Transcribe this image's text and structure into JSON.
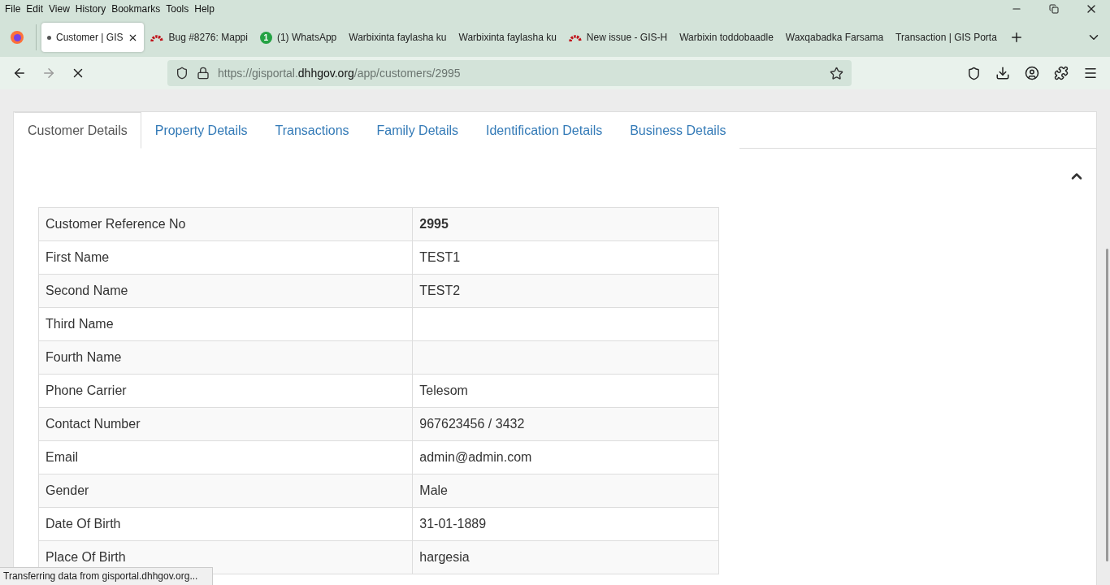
{
  "menu": [
    "File",
    "Edit",
    "View",
    "History",
    "Bookmarks",
    "Tools",
    "Help"
  ],
  "browser_tabs": [
    {
      "title": "Customer | GIS",
      "selected": true,
      "kind": "dot"
    },
    {
      "title": "Bug #8276: Mappi",
      "selected": false,
      "kind": "arc"
    },
    {
      "title": "(1) WhatsApp",
      "selected": false,
      "kind": "chat",
      "badge": "1"
    },
    {
      "title": "Warbixinta faylasha ku",
      "selected": false,
      "kind": "plain"
    },
    {
      "title": "Warbixinta faylasha ku",
      "selected": false,
      "kind": "plain"
    },
    {
      "title": "New issue - GIS-H",
      "selected": false,
      "kind": "arc"
    },
    {
      "title": "Warbixin toddobaadle",
      "selected": false,
      "kind": "plain"
    },
    {
      "title": "Waxqabadka Farsama",
      "selected": false,
      "kind": "plain"
    },
    {
      "title": "Transaction | GIS Porta",
      "selected": false,
      "kind": "plain"
    }
  ],
  "address": {
    "prefix": "https://gisportal.",
    "domain": "dhhgov.org",
    "path": "/app/customers/2995"
  },
  "page_tabs": [
    {
      "label": "Customer Details",
      "selected": true
    },
    {
      "label": "Property Details",
      "selected": false
    },
    {
      "label": "Transactions",
      "selected": false
    },
    {
      "label": "Family Details",
      "selected": false
    },
    {
      "label": "Identification Details",
      "selected": false
    },
    {
      "label": "Business Details",
      "selected": false
    }
  ],
  "details": [
    {
      "label": "Customer Reference No",
      "value": "2995",
      "bold": true
    },
    {
      "label": "First Name",
      "value": "TEST1",
      "bold": false
    },
    {
      "label": "Second Name",
      "value": "TEST2",
      "bold": false
    },
    {
      "label": "Third Name",
      "bold": false
    },
    {
      "label": "Fourth Name",
      "bold": false
    },
    {
      "label": "Phone Carrier",
      "value": "Telesom",
      "bold": false
    },
    {
      "label": "Contact Number",
      "value": "967623456 / 3432",
      "bold": false
    },
    {
      "label": "Email",
      "value": "admin@admin.com",
      "bold": false
    },
    {
      "label": "Gender",
      "value": "Male",
      "bold": false
    },
    {
      "label": "Date Of Birth",
      "value": "31-01-1889",
      "bold": false
    },
    {
      "label": "Place Of Birth",
      "value": "hargesia",
      "bold": false
    }
  ],
  "status": "Transferring data from gisportal.dhhgov.org..."
}
